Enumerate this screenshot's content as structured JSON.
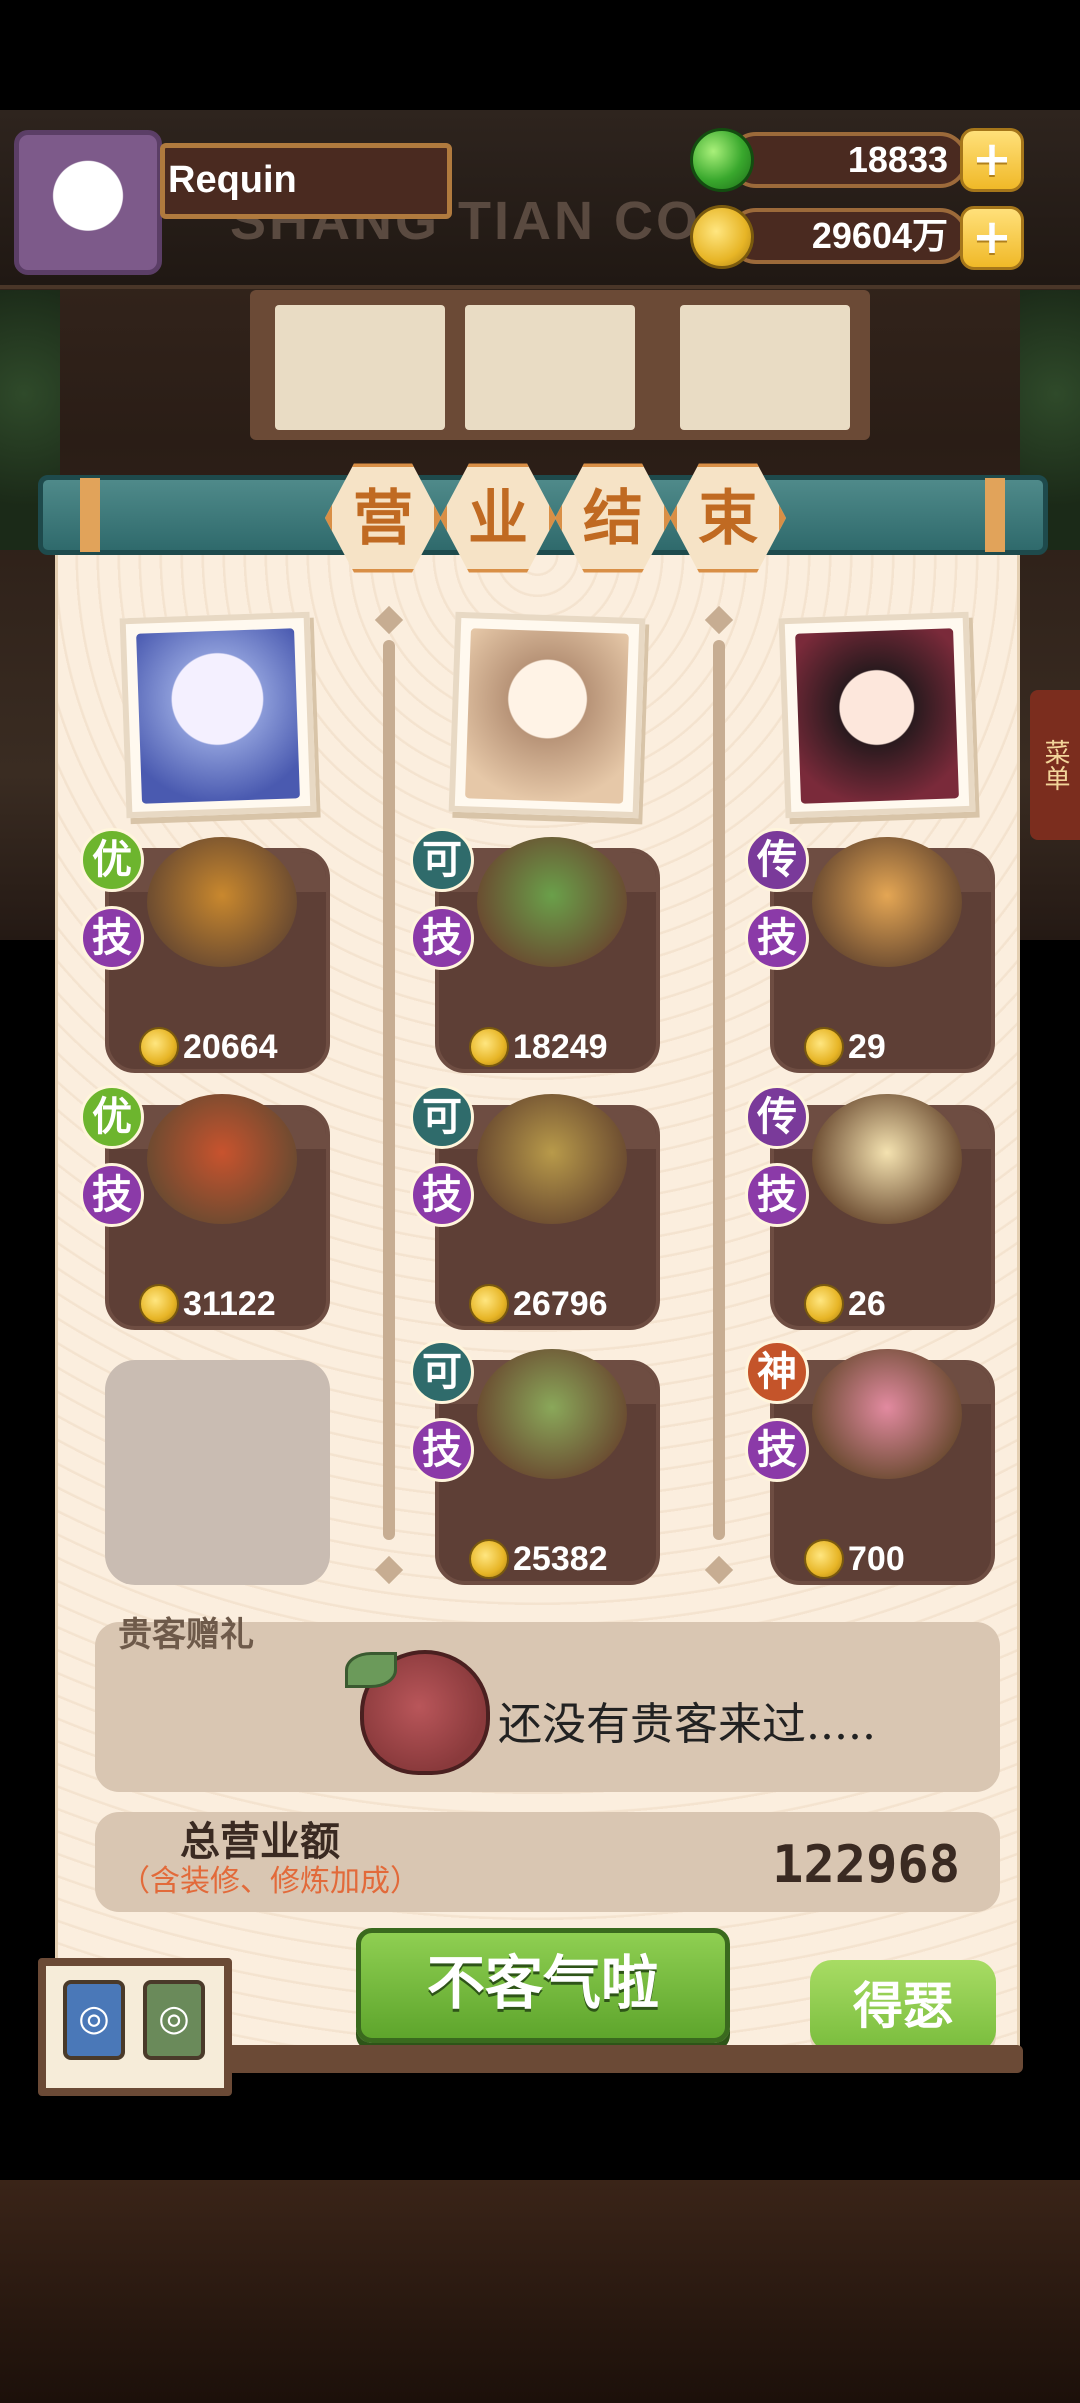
{
  "player": {
    "name": "Requin"
  },
  "resources": {
    "jade": "18833",
    "coins": "29604万"
  },
  "background": {
    "shop_sign": "SHANG TIAN CO",
    "side_tab": "菜单"
  },
  "title_chars": [
    "营",
    "业",
    "结",
    "束"
  ],
  "columns": [
    {
      "dishes": [
        {
          "grade": "优",
          "skill": "技",
          "value": "20664",
          "color": "#c9882e"
        },
        {
          "grade": "优",
          "skill": "技",
          "value": "31122",
          "color": "#c8532e"
        },
        {
          "empty": true
        }
      ]
    },
    {
      "dishes": [
        {
          "grade": "可",
          "skill": "技",
          "value": "18249",
          "color": "#6aa04a"
        },
        {
          "grade": "可",
          "skill": "技",
          "value": "26796",
          "color": "#b89a4a"
        },
        {
          "grade": "可",
          "skill": "技",
          "value": "25382",
          "color": "#8aa85a"
        }
      ]
    },
    {
      "dishes": [
        {
          "grade": "传",
          "skill": "技",
          "value": "29",
          "color": "#e4a654"
        },
        {
          "grade": "传",
          "skill": "技",
          "value": "26",
          "color": "#f4e2b0"
        },
        {
          "grade": "神",
          "skill": "技",
          "value": "700",
          "color": "#e28aa0"
        }
      ]
    }
  ],
  "vip": {
    "title": "贵客赠礼",
    "message": "还没有贵客来过....."
  },
  "total": {
    "label": "总营业额",
    "note": "（含装修、修炼加成）",
    "value": "122968"
  },
  "buttons": {
    "main": "不客气啦",
    "side": "得瑟"
  }
}
